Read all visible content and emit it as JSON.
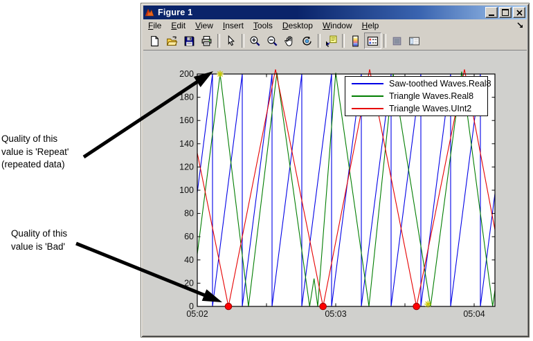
{
  "window": {
    "title": "Figure 1",
    "menu": [
      "File",
      "Edit",
      "View",
      "Insert",
      "Tools",
      "Desktop",
      "Window",
      "Help"
    ],
    "toolbar": [
      {
        "name": "new-figure",
        "icon": "new-document"
      },
      {
        "name": "open-file",
        "icon": "open-folder"
      },
      {
        "name": "save-figure",
        "icon": "save-floppy"
      },
      {
        "name": "print-figure",
        "icon": "printer"
      },
      {
        "sep": true
      },
      {
        "name": "edit-plot",
        "icon": "arrow-cursor"
      },
      {
        "sep": true
      },
      {
        "name": "zoom-in",
        "icon": "zoom-in"
      },
      {
        "name": "zoom-out",
        "icon": "zoom-out"
      },
      {
        "name": "pan",
        "icon": "pan-hand"
      },
      {
        "name": "rotate-3d",
        "icon": "rotate-3d"
      },
      {
        "sep": true
      },
      {
        "name": "data-cursor",
        "icon": "data-cursor"
      },
      {
        "sep": true
      },
      {
        "name": "insert-colorbar",
        "icon": "colorbar"
      },
      {
        "name": "insert-legend",
        "icon": "legend",
        "pressed": true
      },
      {
        "sep": true
      },
      {
        "name": "hide-plot-tools",
        "icon": "hide-plot-tools"
      },
      {
        "name": "show-plot-tools",
        "icon": "plot-tools"
      }
    ]
  },
  "annotations": {
    "repeat_note": {
      "lines": [
        "Quality of this",
        "value is 'Repeat'",
        "(repeated data)"
      ]
    },
    "bad_note": {
      "lines": [
        "Quality of this",
        "value is 'Bad'"
      ]
    },
    "arrows": [
      {
        "name": "repeat-arrow",
        "from": [
          121,
          227
        ],
        "to": [
          308,
          103
        ]
      },
      {
        "name": "bad-arrow",
        "from": [
          110,
          352
        ],
        "to": [
          321,
          437
        ]
      }
    ]
  },
  "chart_data": {
    "type": "line",
    "title": "",
    "xlabel": "",
    "ylabel": "",
    "grid": false,
    "legend_position": "northeast",
    "xlim": [
      0,
      129
    ],
    "ylim": [
      0,
      200
    ],
    "x_unit": "seconds after 05:02:00",
    "x_ticks": [
      {
        "t": 0,
        "label": "05:02"
      },
      {
        "t": 30,
        "label": ""
      },
      {
        "t": 60,
        "label": "05:03"
      },
      {
        "t": 90,
        "label": ""
      },
      {
        "t": 120,
        "label": "05:04"
      }
    ],
    "y_ticks": [
      0,
      20,
      40,
      60,
      80,
      100,
      120,
      140,
      160,
      180,
      200
    ],
    "series": [
      {
        "name": "Saw-toothed Waves.Real8",
        "color": "#0000E6",
        "points": [
          [
            0,
            98
          ],
          [
            6.6,
            200
          ],
          [
            6.6,
            0
          ],
          [
            19.5,
            200
          ],
          [
            19.5,
            0
          ],
          [
            32.4,
            200
          ],
          [
            32.4,
            0
          ],
          [
            45.3,
            200
          ],
          [
            45.3,
            0
          ],
          [
            58.2,
            200
          ],
          [
            58.2,
            0
          ],
          [
            71.1,
            200
          ],
          [
            71.1,
            0
          ],
          [
            84,
            200
          ],
          [
            84,
            0
          ],
          [
            96.9,
            200
          ],
          [
            96.9,
            0
          ],
          [
            109.8,
            200
          ],
          [
            109.8,
            0
          ],
          [
            122.7,
            200
          ],
          [
            122.7,
            0
          ],
          [
            129,
            97
          ]
        ]
      },
      {
        "name": "Triangle Waves.Real8",
        "color": "#007D00",
        "points": [
          [
            0,
            45
          ],
          [
            9.9,
            200
          ],
          [
            22.2,
            0
          ],
          [
            34.5,
            201
          ],
          [
            48.7,
            0
          ],
          [
            50.6,
            24
          ],
          [
            52.2,
            0
          ],
          [
            60,
            201
          ],
          [
            74.4,
            0
          ],
          [
            84.9,
            200
          ],
          [
            101.1,
            0
          ],
          [
            114.6,
            202
          ],
          [
            128,
            0
          ],
          [
            129,
            14
          ]
        ]
      },
      {
        "name": "Triangle Waves.UInt2",
        "color": "#E60000",
        "points": [
          [
            0,
            132
          ],
          [
            13.5,
            0
          ],
          [
            33.9,
            204
          ],
          [
            54.5,
            0
          ],
          [
            74.7,
            204
          ],
          [
            95,
            0
          ],
          [
            115.8,
            204
          ],
          [
            129,
            66
          ]
        ]
      }
    ],
    "markers": {
      "bad": {
        "shape": "circle",
        "color": "#FF0000",
        "edge": "#990000",
        "meaning": "Quality of this value is 'Bad'",
        "points": [
          [
            13.5,
            0
          ],
          [
            54.5,
            0
          ],
          [
            95,
            0
          ]
        ]
      },
      "repeat": {
        "shape": "asterisk",
        "color": "#C9C900",
        "meaning": "Quality of this value is 'Repeat' (repeated data)",
        "points": [
          [
            9.9,
            200
          ],
          [
            100,
            2
          ]
        ]
      }
    }
  }
}
